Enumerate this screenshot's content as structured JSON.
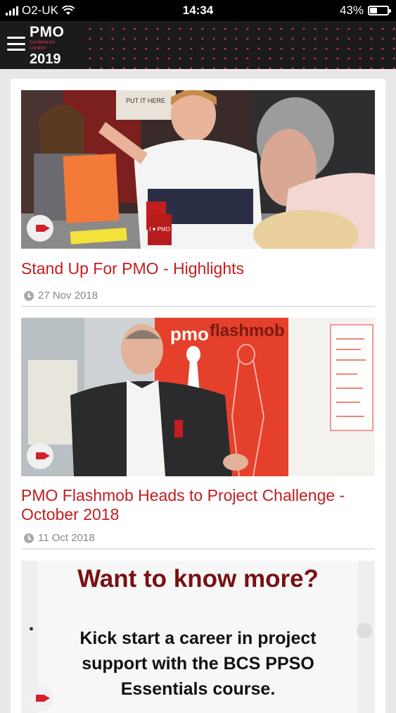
{
  "status_bar": {
    "carrier": "O2-UK",
    "time": "14:34",
    "battery": "43%",
    "battery_level": 0.43
  },
  "header": {
    "logo_line1": "PMO",
    "logo_line2": "Conference",
    "logo_line3": "London",
    "logo_year": "2019",
    "accent_color": "#e0315a"
  },
  "posts": [
    {
      "title": "Stand Up For PMO - Highlights",
      "date": "27 Nov 2018",
      "icon": "video-camera-icon",
      "sign_text": "PUT IT HERE",
      "mug_text": "I ♥ PMO"
    },
    {
      "title": "PMO Flashmob Heads to Project Challenge - October 2018",
      "date": "11 Oct 2018",
      "icon": "video-camera-icon",
      "banner_left": "pmo",
      "banner_right": "flashmob"
    }
  ],
  "promo": {
    "headline": "Want to know more?",
    "line1": "Kick start a career in project",
    "line2": "support with the BCS PPSO",
    "line3": "Essentials course."
  },
  "colors": {
    "title_red": "#c41d20",
    "header_bg": "#1b1b1b"
  }
}
